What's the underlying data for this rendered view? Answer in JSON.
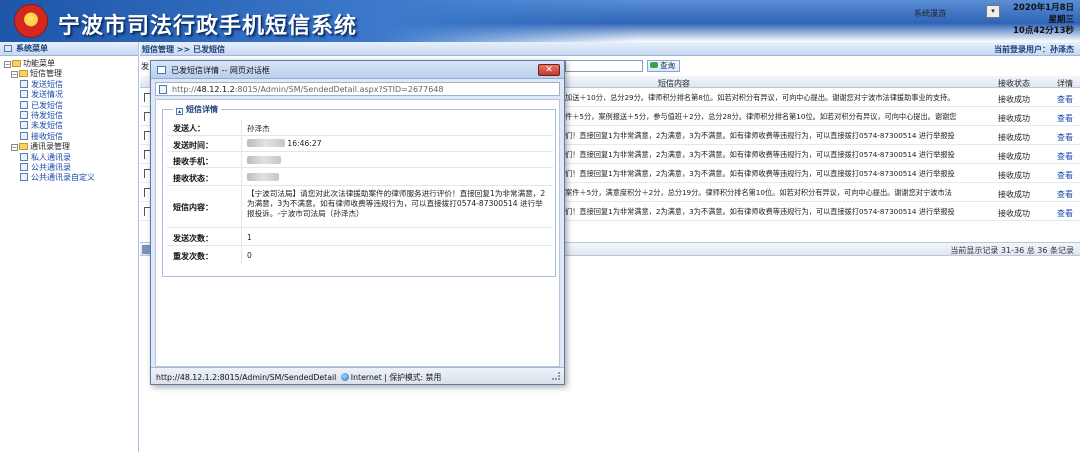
{
  "header": {
    "app_title": "宁波市司法行政手机短信系统",
    "nav_label": "系统漫游",
    "nav_select_value": "▾",
    "date": "2020年1月8日",
    "weekday": "星期三",
    "time": "10点42分13秒"
  },
  "sidebar": {
    "title": "系统菜单",
    "root": "功能菜单",
    "groups": [
      {
        "label": "短信管理",
        "items": [
          "发送短信",
          "发送情况",
          "已发短信",
          "待发短信",
          "未发短信",
          "接收短信"
        ]
      },
      {
        "label": "通讯录管理",
        "items": [
          "私人通讯录",
          "公共通讯录",
          "公共通讯录自定义"
        ]
      }
    ]
  },
  "main": {
    "breadcrumb": "短信管理 >> 已发短信",
    "current_user": "当前登录用户：孙泽杰",
    "left_cut_label": "发",
    "query_button": "查询",
    "columns": {
      "content": "短信内容",
      "status": "接收状态",
      "detail": "详情"
    },
    "rows": [
      {
        "content": "加送＋10分，总分29分。律师积分排名第8位。如若对积分有异议，可向中心提出。谢谢您对宁波市法律援助事业的支持。",
        "status": "接收成功",
        "view": "查看"
      },
      {
        "content": "件＋5分，案例报送＋5分，参与值班＋2分，总分28分。律师积分排名第10位。如若对积分有异议，可向中心提出。谢谢您",
        "status": "接收成功",
        "view": "查看"
      },
      {
        "content": "们！直接回复1为非常满意，2为满意，3为不满意。如有律师收费等违规行为，可以直接拨打0574-87300514 进行举报投",
        "status": "接收成功",
        "view": "查看"
      },
      {
        "content": "们！直接回复1为非常满意，2为满意，3为不满意。如有律师收费等违规行为，可以直接拨打0574-87300514 进行举报投",
        "status": "接收成功",
        "view": "查看"
      },
      {
        "content": "们！直接回复1为非常满意，2为满意，3为不满意。如有律师收费等违规行为，可以直接拨打0574-87300514 进行举报投",
        "status": "接收成功",
        "view": "查看"
      },
      {
        "content": "案件＋5分，满意度积分＋2分，总分19分。律师积分排名第10位。如若对积分有异议，可向中心提出。谢谢您对宁波市法",
        "status": "接收成功",
        "view": "查看"
      },
      {
        "content": "们！直接回复1为非常满意，2为满意，3为不满意。如有律师收费等违规行为，可以直接拨打0574-87300514 进行举报投",
        "status": "接收成功",
        "view": "查看"
      }
    ],
    "pager_text": "当前显示记录 31-36 总 36 条记录"
  },
  "dialog": {
    "title": "已发短信详情 -- 网页对话框",
    "close_label": "✕",
    "url_prefix": "http://",
    "url_host": "48.12.1.2",
    "url_path": ":8015/Admin/SM/SendedDetail.aspx?STID=2677648",
    "section_title": "短信详情",
    "fields": {
      "sender_label": "发送人：",
      "sender_value": "孙泽杰",
      "send_time_label": "发送时间：",
      "send_time_value": "16:46:27",
      "receiver_label": "接收手机：",
      "status_label": "接收状态：",
      "content_label": "短信内容：",
      "content_value": "【宁波司法局】请您对此次法律援助案件的律师服务进行评价！直接回复1为非常满意，2为满意，3为不满意。如有律师收费等违规行为，可以直接拨打0574-87300514 进行举报投诉。-宁波市司法局（孙泽杰）",
      "send_count_label": "发送次数：",
      "send_count_value": "1",
      "resend_count_label": "重发次数：",
      "resend_count_value": "0"
    },
    "status_bar": {
      "url": "http://48.12.1.2:8015/Admin/SM/SendedDetail",
      "zone": "Internet",
      "protected": "| 保护模式: 禁用"
    }
  }
}
